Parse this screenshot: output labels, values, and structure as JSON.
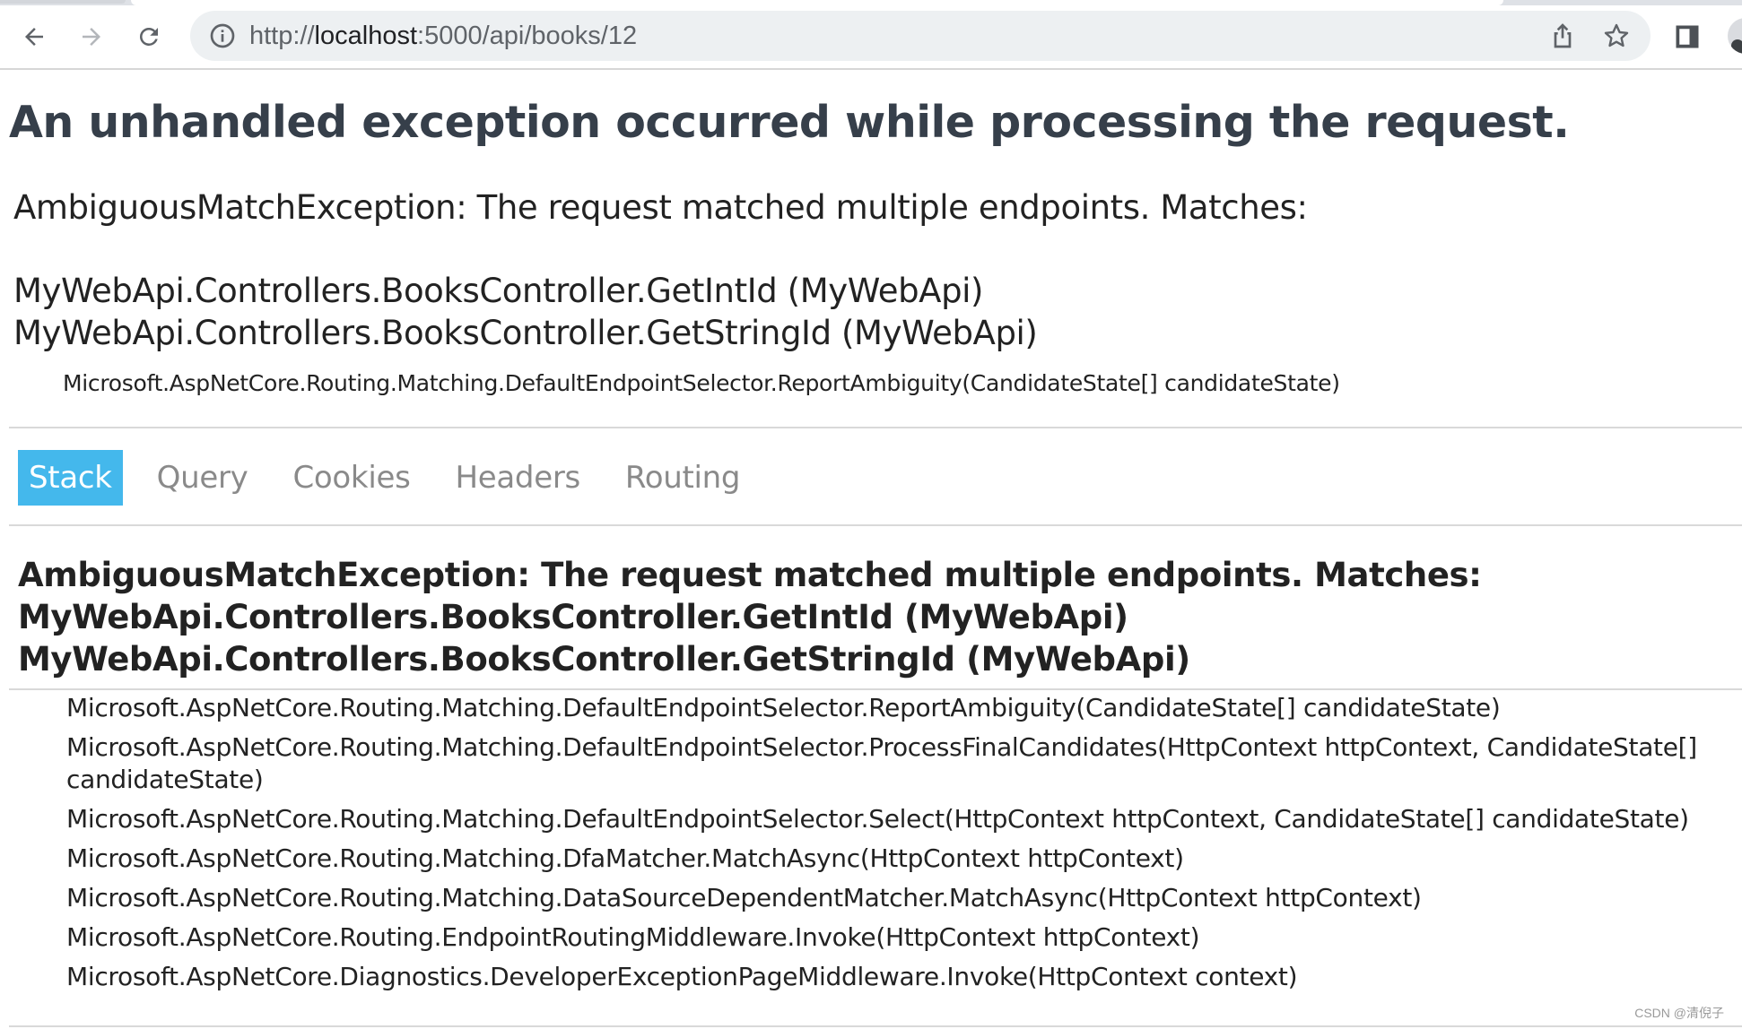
{
  "browser": {
    "url_prefix": "http://",
    "url_host": "localhost",
    "url_rest": ":5000/api/books/12",
    "icons": {
      "back": "arrow-left",
      "forward": "arrow-right",
      "reload": "reload",
      "site_info": "info-circle",
      "share": "share",
      "bookmark": "star",
      "side_panel": "side-panel",
      "profile": "profile-avatar"
    }
  },
  "page": {
    "title": "An unhandled exception occurred while processing the request.",
    "error_title": "AmbiguousMatchException: The request matched multiple endpoints. Matches:",
    "matches": [
      "MyWebApi.Controllers.BooksController.GetIntId (MyWebApi)",
      "MyWebApi.Controllers.BooksController.GetStringId (MyWebApi)"
    ],
    "location": "Microsoft.AspNetCore.Routing.Matching.DefaultEndpointSelector.ReportAmbiguity(CandidateState[] candidateState)",
    "tabs": [
      {
        "label": "Stack",
        "selected": true
      },
      {
        "label": "Query",
        "selected": false
      },
      {
        "label": "Cookies",
        "selected": false
      },
      {
        "label": "Headers",
        "selected": false
      },
      {
        "label": "Routing",
        "selected": false
      }
    ],
    "stack_header": [
      "AmbiguousMatchException: The request matched multiple endpoints. Matches:",
      "MyWebApi.Controllers.BooksController.GetIntId (MyWebApi)",
      "MyWebApi.Controllers.BooksController.GetStringId (MyWebApi)"
    ],
    "frames": [
      "Microsoft.AspNetCore.Routing.Matching.DefaultEndpointSelector.ReportAmbiguity(CandidateState[] candidateState)",
      "Microsoft.AspNetCore.Routing.Matching.DefaultEndpointSelector.ProcessFinalCandidates(HttpContext httpContext, CandidateState[] candidateState)",
      "Microsoft.AspNetCore.Routing.Matching.DefaultEndpointSelector.Select(HttpContext httpContext, CandidateState[] candidateState)",
      "Microsoft.AspNetCore.Routing.Matching.DfaMatcher.MatchAsync(HttpContext httpContext)",
      "Microsoft.AspNetCore.Routing.Matching.DataSourceDependentMatcher.MatchAsync(HttpContext httpContext)",
      "Microsoft.AspNetCore.Routing.EndpointRoutingMiddleware.Invoke(HttpContext httpContext)",
      "Microsoft.AspNetCore.Diagnostics.DeveloperExceptionPageMiddleware.Invoke(HttpContext context)"
    ],
    "watermark": "CSDN @清倪子"
  },
  "colors": {
    "heading": "#363f4a",
    "tab_selected_bg": "#44b8ec",
    "tab_text": "#8a8a8a",
    "divider": "#d9d9d9"
  }
}
